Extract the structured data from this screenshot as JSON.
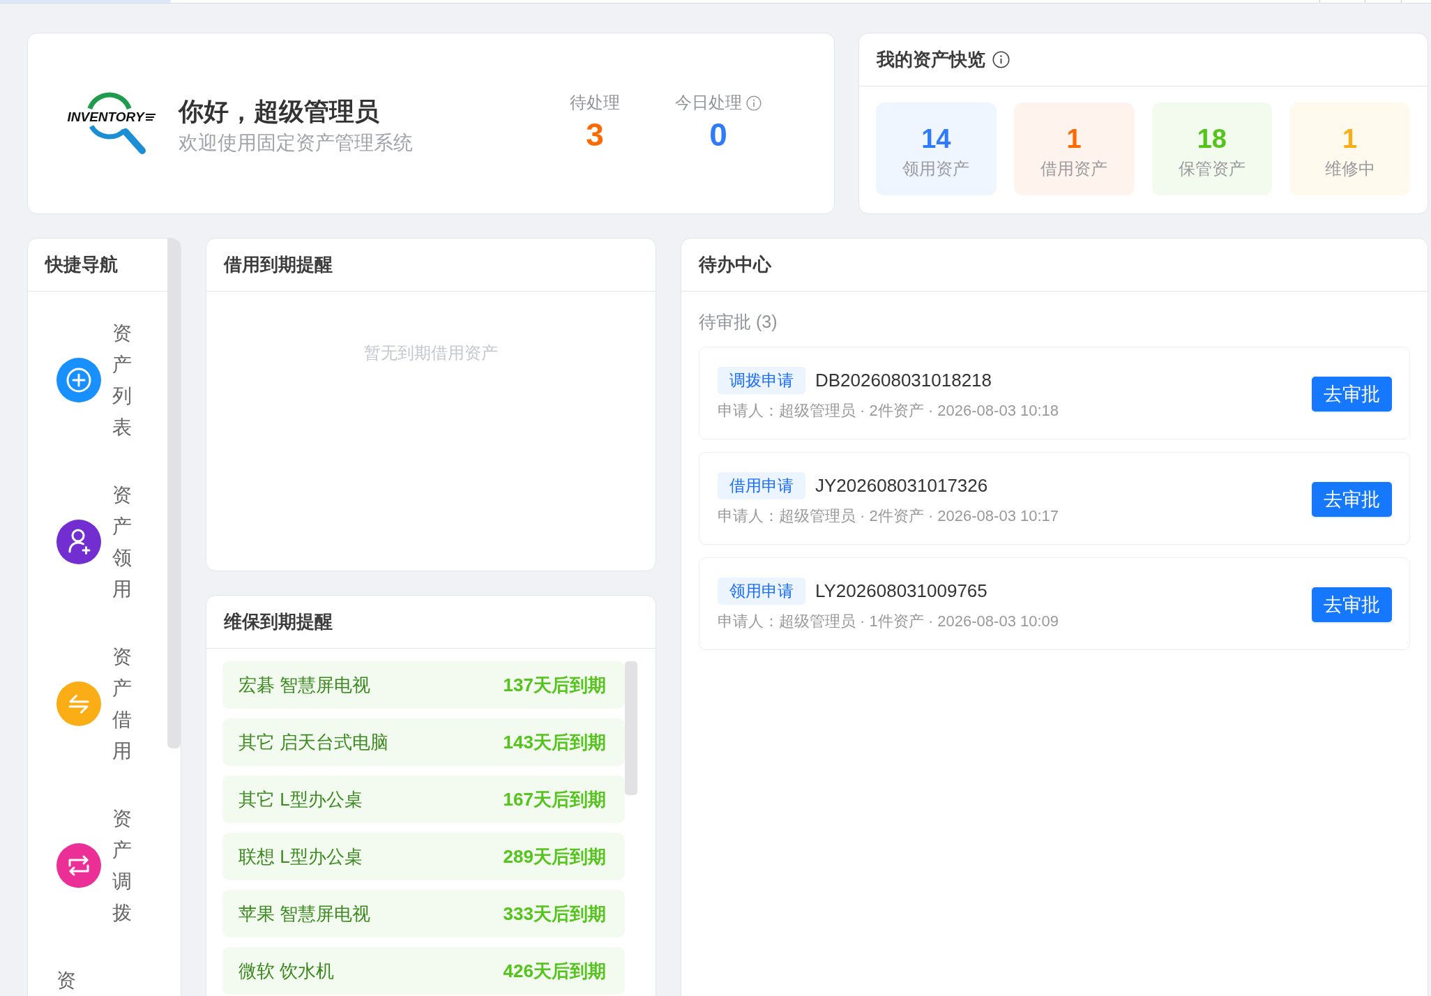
{
  "welcome": {
    "logo_text": "INVENTORY",
    "greeting": "你好，超级管理员",
    "subtitle": "欢迎使用固定资产管理系统",
    "stats": [
      {
        "label": "待处理",
        "value": "3",
        "color": "#ff6a00",
        "has_info": false
      },
      {
        "label": "今日处理",
        "value": "0",
        "color": "#2f7bff",
        "has_info": true
      }
    ]
  },
  "asset_overview": {
    "title": "我的资产快览",
    "has_info": true,
    "tiles": [
      {
        "value": "14",
        "label": "领用资产",
        "color": "#2f7bff"
      },
      {
        "value": "1",
        "label": "借用资产",
        "color": "#ff6a00"
      },
      {
        "value": "18",
        "label": "保管资产",
        "color": "#52c41a"
      },
      {
        "value": "1",
        "label": "维修中",
        "color": "#faad14"
      }
    ]
  },
  "quick_nav": {
    "title": "快捷导航",
    "items": [
      {
        "label": "资产列表",
        "kind": "plus-circle",
        "color": "#1890ff"
      },
      {
        "label": "资产领用",
        "kind": "user-add",
        "color": "#722ed1"
      },
      {
        "label": "资产借用",
        "kind": "swap",
        "color": "#faad14"
      },
      {
        "label": "资产调拨",
        "kind": "loop",
        "color": "#eb2f96"
      },
      {
        "label": "资"
      }
    ]
  },
  "loan_reminder": {
    "title": "借用到期提醒",
    "empty_text": "暂无到期借用资产"
  },
  "maintenance_reminder": {
    "title": "维保到期提醒",
    "items": [
      {
        "name": "宏碁 智慧屏电视",
        "due": "137天后到期"
      },
      {
        "name": "其它 启天台式电脑",
        "due": "143天后到期"
      },
      {
        "name": "其它 L型办公桌",
        "due": "167天后到期"
      },
      {
        "name": "联想 L型办公桌",
        "due": "289天后到期"
      },
      {
        "name": "苹果 智慧屏电视",
        "due": "333天后到期"
      },
      {
        "name": "微软 饮水机",
        "due": "426天后到期"
      }
    ]
  },
  "todo_center": {
    "title": "待办中心",
    "section": "待审批 (3)",
    "items": [
      {
        "tag": "调拨申请",
        "number": "DB202608031018218",
        "meta": "申请人：超级管理员 · 2件资产 · 2026-08-03 10:18",
        "button": "去审批"
      },
      {
        "tag": "借用申请",
        "number": "JY202608031017326",
        "meta": "申请人：超级管理员 · 2件资产 · 2026-08-03 10:17",
        "button": "去审批"
      },
      {
        "tag": "领用申请",
        "number": "LY202608031009765",
        "meta": "申请人：超级管理员 · 1件资产 · 2026-08-03 10:09",
        "button": "去审批"
      }
    ]
  }
}
